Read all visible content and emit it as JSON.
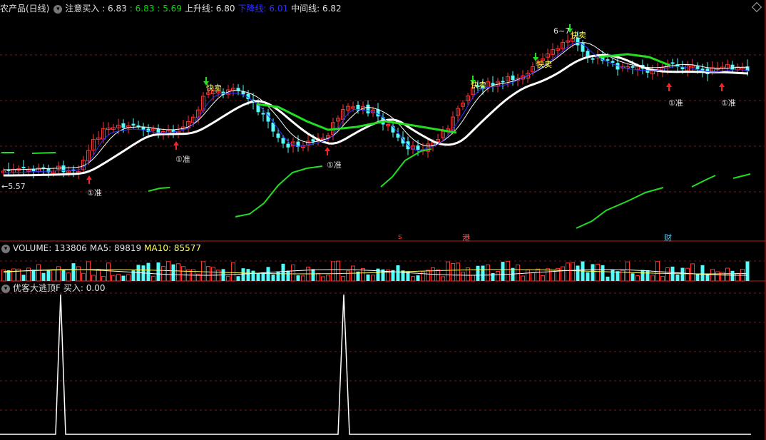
{
  "main_header": {
    "symbol": "农产品(日线)",
    "buy_attention": "注意买入 : 6.83",
    "v1": ": 6.83",
    "v2": ": 5.69",
    "up_line": "上升线: 6.80",
    "down_line": "下降线: 6.01",
    "mid_line": "中间线: 6.82"
  },
  "volume_header": {
    "volume": "VOLUME: 133806",
    "ma5": "MA5: 89819",
    "ma10": "MA10: 85577"
  },
  "indicator_header": {
    "name": "优客大逃顶F",
    "buy": "买入: 0.00"
  },
  "annotations": {
    "low_price": "←5.57",
    "high_price": "6~7",
    "sell_label": "快卖",
    "zhun_label": "①准",
    "event_s": "s",
    "event_gang": "港",
    "event_cai": "财"
  },
  "colors": {
    "up": "#ff3232",
    "down": "#54fcfc",
    "white_ma": "#ffffff",
    "green_ma": "#22dd22",
    "frame": "#b02020"
  },
  "icons": [
    "option-icon",
    "diamond-icon",
    "up-arrow-icon",
    "down-arrow-icon"
  ]
}
